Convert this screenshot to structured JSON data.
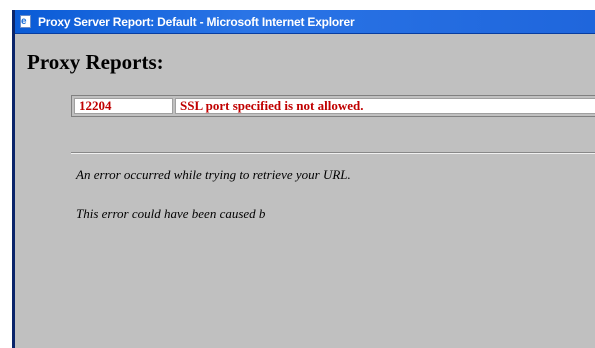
{
  "window": {
    "title": "Proxy Server Report: Default - Microsoft Internet Explorer",
    "icon": "ie-page-icon",
    "titlebar_color": "#0a5bd6"
  },
  "page": {
    "heading": "Proxy Reports:",
    "error": {
      "code": "12204",
      "description": "SSL port specified is not allowed.",
      "text_color": "#c00000"
    },
    "messages": [
      "An error occurred while trying to retrieve your URL.",
      "This error could have been caused b"
    ],
    "background_color": "#c0c0c0"
  }
}
